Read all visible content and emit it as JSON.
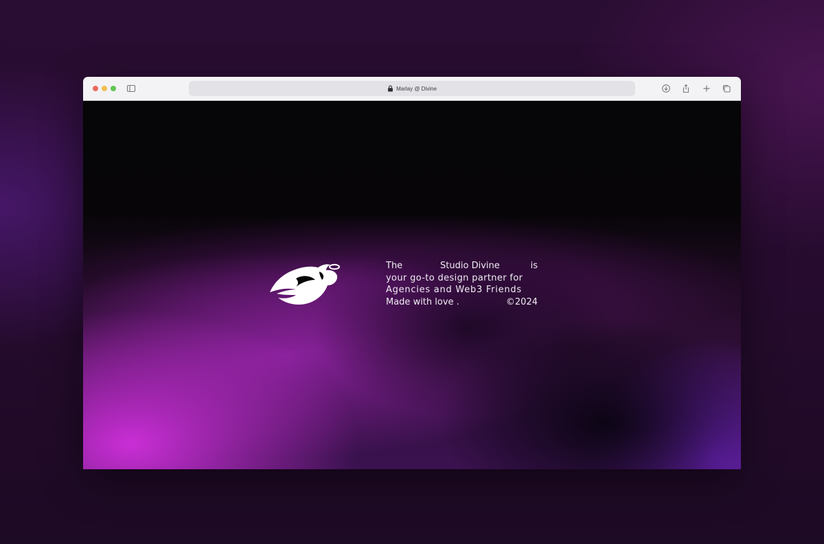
{
  "browser": {
    "url_label": "Marlay @ Divine",
    "icons": [
      "sidebar-icon",
      "lock-icon",
      "download-icon",
      "share-icon",
      "new-tab-icon",
      "tab-overview-icon"
    ],
    "colors": {
      "close": "#ed6a5e",
      "minimize": "#f4be4f",
      "maximize": "#61c554"
    }
  },
  "page": {
    "logo_name": "angel-logo",
    "tagline": {
      "row1": [
        "The",
        "Studio Divine",
        "is"
      ],
      "row2": "your go-to design partner for",
      "row3": "Agencies and Web3 Friends",
      "row4": [
        "Made with love .",
        "©2024"
      ]
    },
    "colors": {
      "text": "#f1ecf4",
      "background": "#060507",
      "glow_magenta": "#d230de",
      "glow_violet": "#7024c4"
    }
  }
}
